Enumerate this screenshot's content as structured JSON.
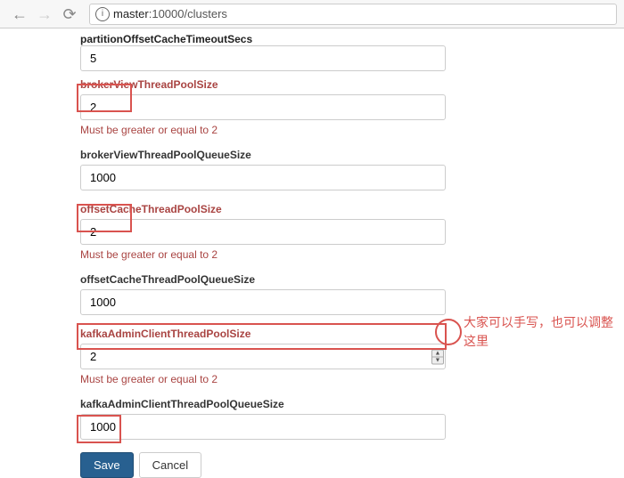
{
  "browser": {
    "url_host": "master",
    "url_path": ":10000/clusters"
  },
  "fields": {
    "partitionOffsetCacheTimeoutSecs": {
      "label": "partitionOffsetCacheTimeoutSecs",
      "value": "5"
    },
    "brokerViewThreadPoolSize": {
      "label": "brokerViewThreadPoolSize",
      "value": "2",
      "help": "Must be greater or equal to 2"
    },
    "brokerViewThreadPoolQueueSize": {
      "label": "brokerViewThreadPoolQueueSize",
      "value": "1000"
    },
    "offsetCacheThreadPoolSize": {
      "label": "offsetCacheThreadPoolSize",
      "value": "2",
      "help": "Must be greater or equal to 2"
    },
    "offsetCacheThreadPoolQueueSize": {
      "label": "offsetCacheThreadPoolQueueSize",
      "value": "1000"
    },
    "kafkaAdminClientThreadPoolSize": {
      "label": "kafkaAdminClientThreadPoolSize",
      "value": "2",
      "help": "Must be greater or equal to 2"
    },
    "kafkaAdminClientThreadPoolQueueSize": {
      "label": "kafkaAdminClientThreadPoolQueueSize",
      "value": "1000"
    }
  },
  "buttons": {
    "save": "Save",
    "cancel": "Cancel"
  },
  "annotation": "大家可以手写，也可以调整这里"
}
